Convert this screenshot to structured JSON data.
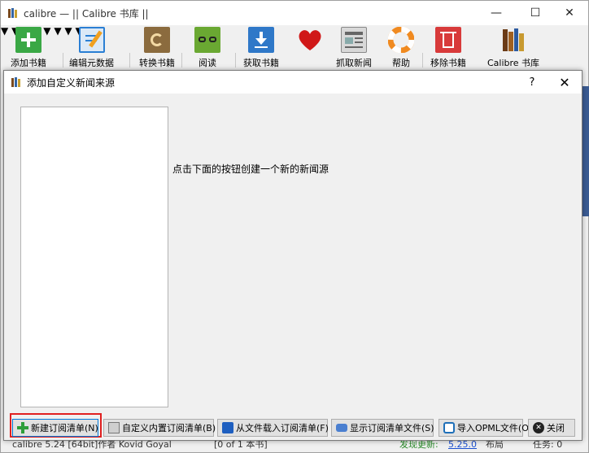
{
  "window": {
    "title": "calibre — || Calibre 书库 ||"
  },
  "toolbar": {
    "items": [
      {
        "label": "添加书籍",
        "icon": "add-book-icon"
      },
      {
        "label": "编辑元数据",
        "icon": "edit-metadata-icon"
      },
      {
        "label": "转换书籍",
        "icon": "convert-books-icon"
      },
      {
        "label": "阅读",
        "icon": "view-book-icon"
      },
      {
        "label": "获取书籍",
        "icon": "get-books-icon"
      },
      {
        "label": "",
        "icon": "donate-heart-icon"
      },
      {
        "label": "抓取新闻",
        "icon": "fetch-news-icon"
      },
      {
        "label": "帮助",
        "icon": "help-lifebuoy-icon"
      },
      {
        "label": "移除书籍",
        "icon": "remove-books-icon"
      },
      {
        "label": "Calibre 书库",
        "icon": "library-icon"
      }
    ]
  },
  "statusbar": {
    "version": "calibre 5.24 [64bit]作者 Kovid Goyal",
    "count": "[0 of 1 本书]",
    "update": "发现更新:",
    "update_version": "5.25.0",
    "layout": "布局",
    "jobs": "任务: 0"
  },
  "dialog": {
    "title": "添加自定义新闻来源",
    "help": "?",
    "close": "✕",
    "hint": "点击下面的按钮创建一个新的新闻源",
    "buttons": {
      "new_recipe": "新建订阅清单(N)",
      "customize_builtin": "自定义内置订阅清单(B)",
      "load_from_file": "从文件载入订阅清单(F)",
      "show_recipe_files": "显示订阅清单文件(S)",
      "import_opml": "导入OPML文件(O)",
      "close": "关闭"
    }
  },
  "colors": {
    "highlight_box": "#e02020",
    "accent_blue": "#0078d7"
  }
}
